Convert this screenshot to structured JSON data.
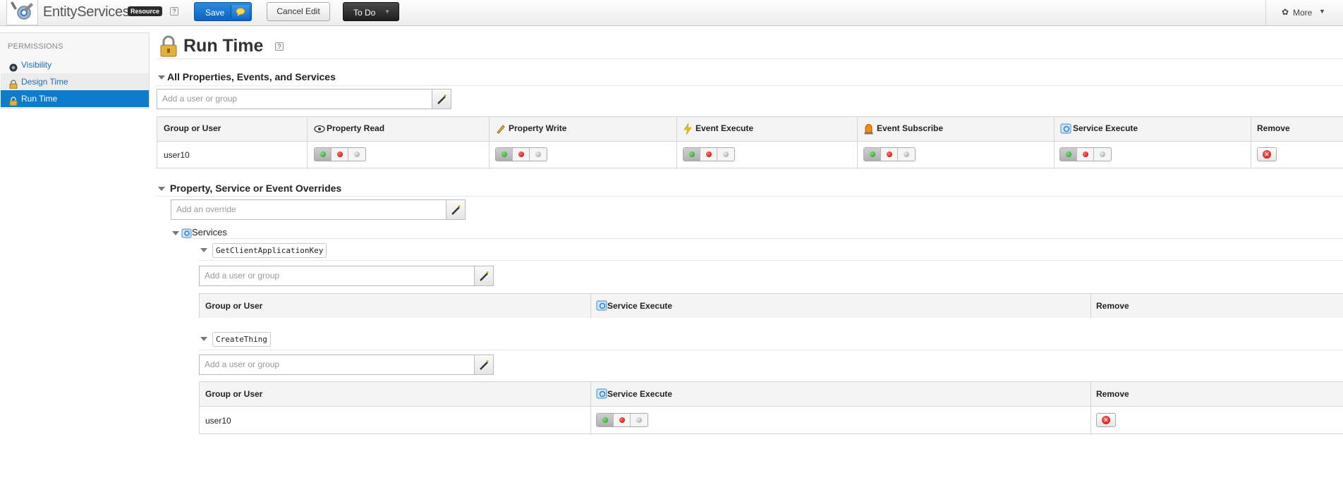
{
  "app": {
    "title": "EntityServices",
    "badge": "Resource",
    "help": "?"
  },
  "toolbar": {
    "save_label": "Save",
    "cancel_label": "Cancel Edit",
    "todo_label": "To Do",
    "more_label": "More"
  },
  "sidebar": {
    "heading": "PERMISSIONS",
    "items": [
      {
        "label": "Visibility",
        "icon": "visibility-icon"
      },
      {
        "label": "Design Time",
        "icon": "lock-icon"
      },
      {
        "label": "Run Time",
        "icon": "lock-icon",
        "selected": true
      }
    ]
  },
  "page": {
    "title": "Run Time",
    "help": "?"
  },
  "all_section": {
    "heading": "All Properties, Events, and Services",
    "add_placeholder": "Add a user or group",
    "columns": [
      "Group or User",
      "Property Read",
      "Property Write",
      "Event Execute",
      "Event Subscribe",
      "Service Execute",
      "Remove"
    ],
    "rows": [
      {
        "user": "user10"
      }
    ]
  },
  "overrides": {
    "heading": "Property, Service or Event Overrides",
    "add_placeholder": "Add an override",
    "group": "Services",
    "items": [
      {
        "name": "GetClientApplicationKey",
        "add_placeholder": "Add a user or group",
        "columns": [
          "Group or User",
          "Service Execute",
          "Remove"
        ],
        "rows": []
      },
      {
        "name": "CreateThing",
        "add_placeholder": "Add a user or group",
        "columns": [
          "Group or User",
          "Service Execute",
          "Remove"
        ],
        "rows": [
          {
            "user": "user10"
          }
        ]
      }
    ]
  },
  "colors": {
    "accent": "#0e7ccc",
    "save": "#1670cc",
    "link": "#1a6fb5"
  }
}
